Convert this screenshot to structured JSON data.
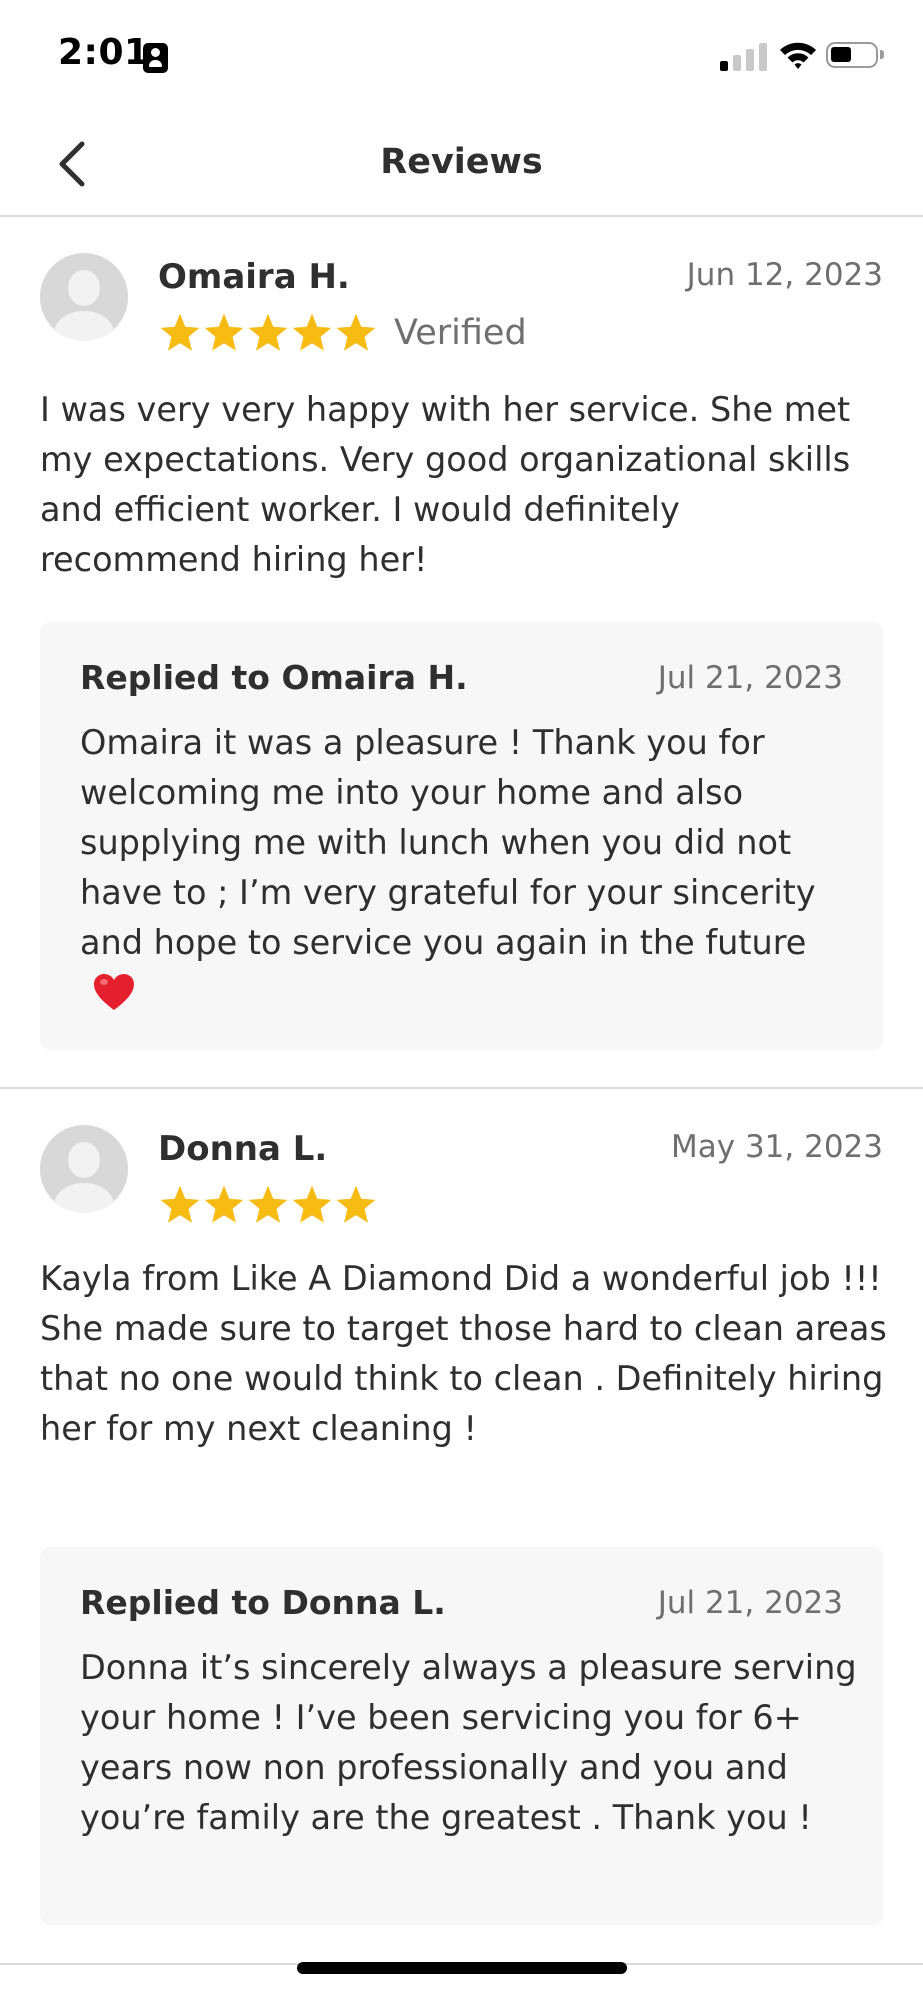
{
  "status_bar": {
    "time": "2:01",
    "icons": [
      "id-badge-icon",
      "cellular-signal-icon",
      "wifi-icon",
      "battery-icon"
    ]
  },
  "nav": {
    "title": "Reviews",
    "back_icon": "chevron-left-icon"
  },
  "reviews": [
    {
      "name": "Omaira H.",
      "date": "Jun 12, 2023",
      "rating": 5,
      "verified_label": "Verified",
      "text": "I was very very happy with her service. She met my expectations. Very good organizational skills and efficient worker. I would definitely recommend hiring her!",
      "reply": {
        "title": "Replied to Omaira H.",
        "date": "Jul 21, 2023",
        "text": "Omaira it was a pleasure ! Thank you for welcoming me into your home and also supplying me with lunch when you did not have to ; I’m very grateful for your sincerity and hope to service you again in the future",
        "emoji_icon": "red-heart-icon"
      }
    },
    {
      "name": "Donna L.",
      "date": "May 31, 2023",
      "rating": 5,
      "text": "Kayla from Like A Diamond Did a wonderful job !!! She made sure to target those hard to clean areas that no one would think to clean . Definitely hiring her for my next cleaning !",
      "reply": {
        "title": "Replied to Donna L.",
        "date": "Jul 21, 2023",
        "text": "Donna it’s sincerely always a pleasure serving your home ! I’ve been servicing you for 6+ years now non professionally and you and you’re family are the greatest . Thank you !"
      }
    }
  ],
  "colors": {
    "star": "#F7BC14",
    "text": "#2F2F2F",
    "muted": "#6F6F6F",
    "reply_bg": "#F7F7F7",
    "divider": "#DCDCDC",
    "heart": "#E5202E"
  }
}
